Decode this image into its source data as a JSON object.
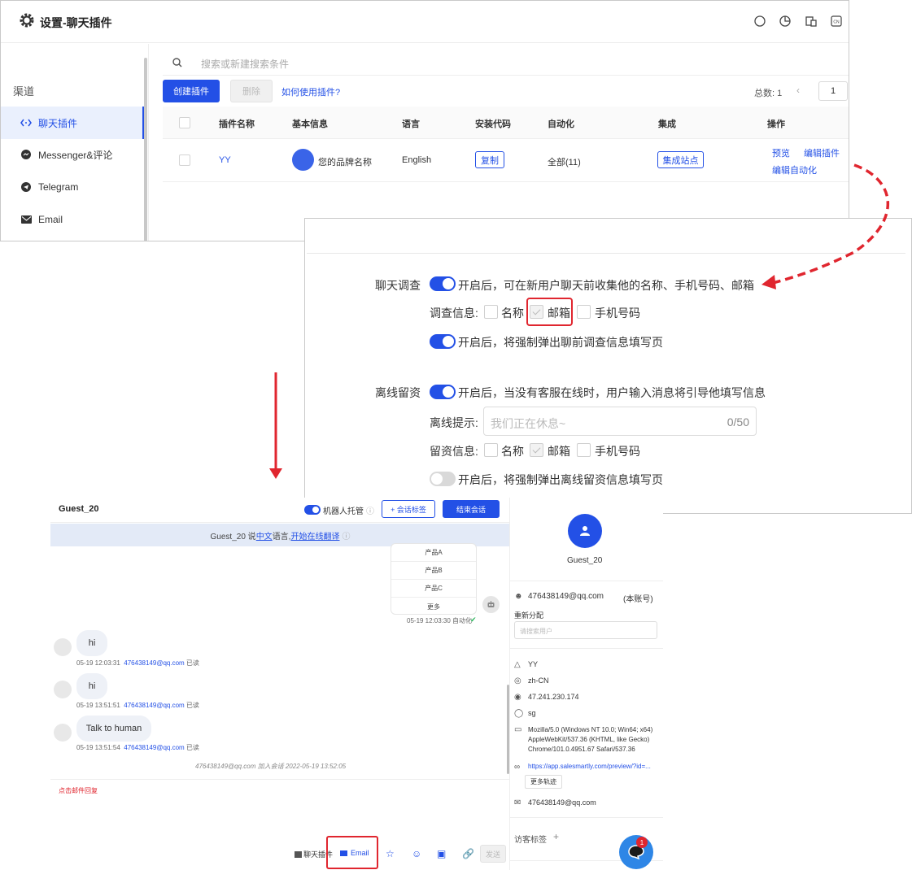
{
  "top_panel": {
    "title": "设置-聊天插件",
    "sidebar": {
      "section": "渠道",
      "items": [
        {
          "label": "聊天插件"
        },
        {
          "label": "Messenger&评论"
        },
        {
          "label": "Telegram"
        },
        {
          "label": "Email"
        }
      ]
    },
    "search_placeholder": "搜索或新建搜索条件",
    "create_button": "创建插件",
    "delete_button": "删除",
    "help_link": "如何使用插件?",
    "total_label": "总数: 1",
    "page_number": "1",
    "table": {
      "headers": [
        "插件名称",
        "基本信息",
        "语言",
        "安装代码",
        "自动化",
        "集成",
        "操作"
      ],
      "row": {
        "name": "YY",
        "brand": "您的品牌名称",
        "language": "English",
        "copy": "复制",
        "automation": "全部(11)",
        "integrate": "集成站点",
        "action_preview": "预览",
        "action_edit": "编辑插件",
        "action_edit_auto": "编辑自动化"
      }
    }
  },
  "settings": {
    "presurvey_label": "聊天调查",
    "presurvey_desc": "开启后，可在新用户聊天前收集他的名称、手机号码、邮箱",
    "survey_info_label": "调查信息:",
    "opt_name": "名称",
    "opt_email": "邮箱",
    "opt_phone": "手机号码",
    "force_presurvey": "开启后，将强制弹出聊前调查信息填写页",
    "offline_label": "离线留资",
    "offline_desc": "开启后，当没有客服在线时，用户输入消息将引导他填写信息",
    "offline_tip_label": "离线提示:",
    "offline_tip_placeholder": "我们正在休息~",
    "offline_tip_count": "0/50",
    "leave_info_label": "留资信息:",
    "force_offline": "开启后，将强制弹出离线留资信息填写页"
  },
  "chat": {
    "guest": "Guest_20",
    "bot_label": "机器人托管",
    "tag_button": "+ 会话标签",
    "end_button": "结束会话",
    "lang_banner_prefix": "Guest_20 说 ",
    "lang_banner_lang": "中文",
    "lang_banner_mid": " 语言, ",
    "lang_banner_action": "开始在线翻译",
    "menu": [
      "产品A",
      "产品B",
      "产品C",
      "更多"
    ],
    "bot_time": "05-19 12:03:30 自动化",
    "messages": [
      {
        "text": "hi",
        "time": "05-19 12:03:31",
        "email": "476438149@qq.com",
        "status": "已读"
      },
      {
        "text": "hi",
        "time": "05-19 13:51:51",
        "email": "476438149@qq.com",
        "status": "已读"
      },
      {
        "text": "Talk to human",
        "time": "05-19 13:51:54",
        "email": "476438149@qq.com",
        "status": "已读"
      }
    ],
    "joined_note": "476438149@qq.com 加入会话 2022-05-19 13:52:05",
    "reply_hint": "点击邮件回复",
    "toolbar_plugin": "聊天插件",
    "toolbar_email": "Email",
    "send_button": "发送",
    "side": {
      "guest": "Guest_20",
      "account": "476438149@qq.com",
      "account_note": "(本账号)",
      "reassign": "重新分配",
      "search_placeholder": "请搜索用户",
      "plugin": "YY",
      "locale": "zh-CN",
      "ip": "47.241.230.174",
      "region": "sg",
      "ua": "Mozilla/5.0 (Windows NT 10.0; Win64; x64) AppleWebKit/537.36 (KHTML, like Gecko) Chrome/101.0.4951.67 Safari/537.36",
      "url": "https://app.salesmartly.com/preview/?id=...",
      "more_trace": "更多轨迹",
      "email": "476438149@qq.com",
      "visitor_tags": "访客标签",
      "badge": "1"
    }
  },
  "colors": {
    "accent": "#2350e6",
    "annotation": "#e0262f"
  }
}
